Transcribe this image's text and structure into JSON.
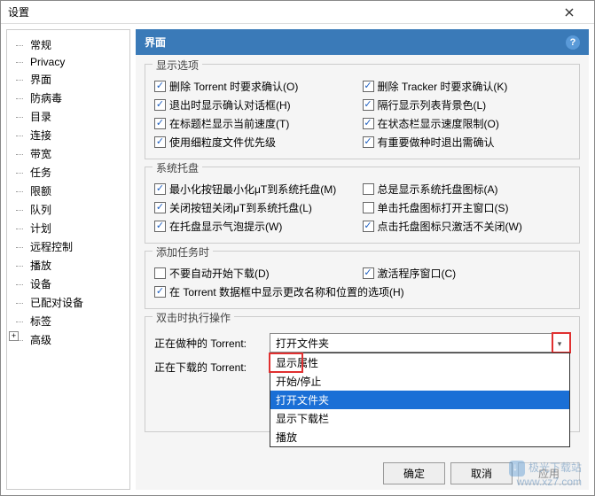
{
  "window": {
    "title": "设置"
  },
  "sidebar": {
    "items": [
      {
        "label": "常规"
      },
      {
        "label": "Privacy"
      },
      {
        "label": "界面"
      },
      {
        "label": "防病毒"
      },
      {
        "label": "目录"
      },
      {
        "label": "连接"
      },
      {
        "label": "带宽"
      },
      {
        "label": "任务"
      },
      {
        "label": "限额"
      },
      {
        "label": "队列"
      },
      {
        "label": "计划"
      },
      {
        "label": "远程控制"
      },
      {
        "label": "播放"
      },
      {
        "label": "设备"
      },
      {
        "label": "已配对设备"
      },
      {
        "label": "标签"
      },
      {
        "label": "高级",
        "expandable": true
      }
    ]
  },
  "header": {
    "title": "界面",
    "help": "?"
  },
  "groups": {
    "display": {
      "title": "显示选项",
      "items": [
        {
          "label": "删除 Torrent 时要求确认(O)",
          "checked": true
        },
        {
          "label": "删除 Tracker 时要求确认(K)",
          "checked": true
        },
        {
          "label": "退出时显示确认对话框(H)",
          "checked": true
        },
        {
          "label": "隔行显示列表背景色(L)",
          "checked": true
        },
        {
          "label": "在标题栏显示当前速度(T)",
          "checked": true
        },
        {
          "label": "在状态栏显示速度限制(O)",
          "checked": true
        },
        {
          "label": "使用细粒度文件优先级",
          "checked": true
        },
        {
          "label": "有重要做种时退出需确认",
          "checked": true
        }
      ]
    },
    "tray": {
      "title": "系统托盘",
      "items": [
        {
          "label": "最小化按钮最小化μT到系统托盘(M)",
          "checked": true
        },
        {
          "label": "总是显示系统托盘图标(A)",
          "checked": false
        },
        {
          "label": "关闭按钮关闭μT到系统托盘(L)",
          "checked": true
        },
        {
          "label": "单击托盘图标打开主窗口(S)",
          "checked": false
        },
        {
          "label": "在托盘显示气泡提示(W)",
          "checked": true
        },
        {
          "label": "点击托盘图标只激活不关闭(W)",
          "checked": true
        }
      ]
    },
    "addtask": {
      "title": "添加任务时",
      "items": [
        {
          "label": "不要自动开始下载(D)",
          "checked": false
        },
        {
          "label": "激活程序窗口(C)",
          "checked": true
        },
        {
          "label": "在 Torrent 数据框中显示更改名称和位置的选项(H)",
          "checked": true,
          "full": true
        }
      ]
    },
    "dclick": {
      "title": "双击时执行操作",
      "seeding_label": "正在做种的 Torrent:",
      "seeding_value": "打开文件夹",
      "downloading_label": "正在下载的 Torrent:",
      "options": [
        {
          "label": "显示属性",
          "highlight": true
        },
        {
          "label": "开始/停止"
        },
        {
          "label": "打开文件夹",
          "selected": true
        },
        {
          "label": "显示下载栏"
        },
        {
          "label": "播放"
        }
      ]
    }
  },
  "buttons": {
    "ok": "确定",
    "cancel": "取消",
    "apply": "应用"
  },
  "watermark": {
    "name": "极光下载站",
    "url": "www.xz7.com"
  }
}
